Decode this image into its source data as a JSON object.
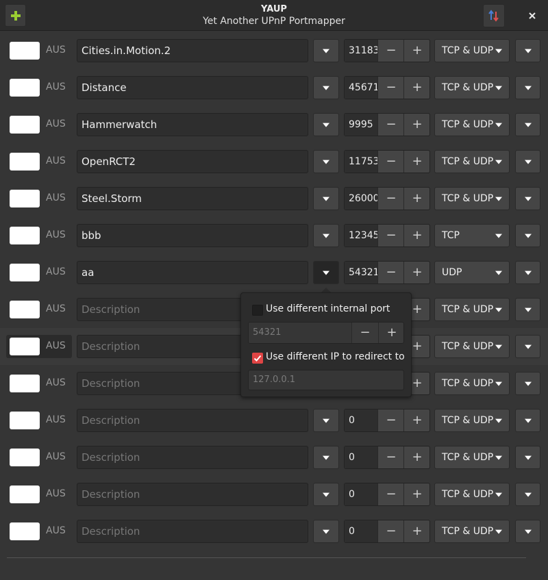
{
  "window": {
    "title": "YAUP",
    "subtitle": "Yet Another UPnP Portmapper",
    "add_icon": "plus-icon",
    "sort_icon": "sort-arrows-icon",
    "close_icon": "close-icon",
    "accent_color": "#9acd32"
  },
  "rows": [
    {
      "status": "AUS",
      "description": "Cities.in.Motion.2",
      "placeholder": "Description",
      "port": "31183",
      "protocol": "TCP & UDP"
    },
    {
      "status": "AUS",
      "description": "Distance",
      "placeholder": "Description",
      "port": "45671",
      "protocol": "TCP & UDP"
    },
    {
      "status": "AUS",
      "description": "Hammerwatch",
      "placeholder": "Description",
      "port": "9995",
      "protocol": "TCP & UDP"
    },
    {
      "status": "AUS",
      "description": "OpenRCT2",
      "placeholder": "Description",
      "port": "11753",
      "protocol": "TCP & UDP"
    },
    {
      "status": "AUS",
      "description": "Steel.Storm",
      "placeholder": "Description",
      "port": "26000",
      "protocol": "TCP & UDP"
    },
    {
      "status": "AUS",
      "description": "bbb",
      "placeholder": "Description",
      "port": "12345",
      "protocol": "TCP"
    },
    {
      "status": "AUS",
      "description": "aa",
      "placeholder": "Description",
      "port": "54321",
      "protocol": "UDP"
    },
    {
      "status": "AUS",
      "description": "",
      "placeholder": "Description",
      "port": "",
      "protocol": "TCP & UDP"
    },
    {
      "status": "AUS",
      "description": "",
      "placeholder": "Description",
      "port": "",
      "protocol": "TCP & UDP"
    },
    {
      "status": "AUS",
      "description": "",
      "placeholder": "Description",
      "port": "",
      "protocol": "TCP & UDP"
    },
    {
      "status": "AUS",
      "description": "",
      "placeholder": "Description",
      "port": "0",
      "protocol": "TCP & UDP"
    },
    {
      "status": "AUS",
      "description": "",
      "placeholder": "Description",
      "port": "0",
      "protocol": "TCP & UDP"
    },
    {
      "status": "AUS",
      "description": "",
      "placeholder": "Description",
      "port": "0",
      "protocol": "TCP & UDP"
    },
    {
      "status": "AUS",
      "description": "",
      "placeholder": "Description",
      "port": "0",
      "protocol": "TCP & UDP"
    }
  ],
  "stepper": {
    "minus": "−",
    "plus": "+"
  },
  "popover": {
    "internal_port_label": "Use different internal port",
    "internal_port_checked": false,
    "internal_port_value": "54321",
    "redirect_ip_label": "Use different IP to redirect to",
    "redirect_ip_checked": true,
    "redirect_ip_value": "127.0.0.1",
    "checkbox_color": "#e04545"
  }
}
